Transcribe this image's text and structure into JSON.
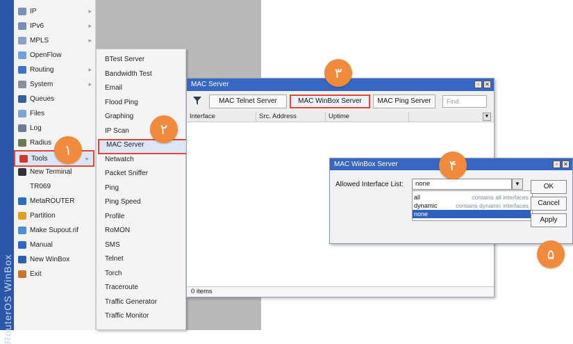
{
  "brand": "RouterOS WinBox",
  "left_menu": {
    "items": [
      {
        "label": "IP",
        "has_arrow": true,
        "icon": "ip-icon"
      },
      {
        "label": "IPv6",
        "has_arrow": true,
        "icon": "ipv6-icon"
      },
      {
        "label": "MPLS",
        "has_arrow": true,
        "icon": "mpls-icon"
      },
      {
        "label": "OpenFlow",
        "has_arrow": false,
        "icon": "openflow-icon"
      },
      {
        "label": "Routing",
        "has_arrow": true,
        "icon": "routing-icon"
      },
      {
        "label": "System",
        "has_arrow": true,
        "icon": "system-icon"
      },
      {
        "label": "Queues",
        "has_arrow": false,
        "icon": "queues-icon"
      },
      {
        "label": "Files",
        "has_arrow": false,
        "icon": "files-icon"
      },
      {
        "label": "Log",
        "has_arrow": false,
        "icon": "log-icon"
      },
      {
        "label": "Radius",
        "has_arrow": false,
        "icon": "radius-icon"
      },
      {
        "label": "Tools",
        "has_arrow": true,
        "icon": "tools-icon"
      },
      {
        "label": "New Terminal",
        "has_arrow": false,
        "icon": "terminal-icon"
      },
      {
        "label": "TR069",
        "has_arrow": false,
        "icon": ""
      },
      {
        "label": "MetaROUTER",
        "has_arrow": false,
        "icon": "metarouter-icon"
      },
      {
        "label": "Partition",
        "has_arrow": false,
        "icon": "partition-icon"
      },
      {
        "label": "Make Supout.rif",
        "has_arrow": false,
        "icon": "supout-icon"
      },
      {
        "label": "Manual",
        "has_arrow": false,
        "icon": "manual-icon"
      },
      {
        "label": "New WinBox",
        "has_arrow": false,
        "icon": "winbox-icon"
      },
      {
        "label": "Exit",
        "has_arrow": false,
        "icon": "exit-icon"
      }
    ]
  },
  "tools_menu": {
    "items": [
      "BTest Server",
      "Bandwidth Test",
      "Email",
      "Flood Ping",
      "Graphing",
      "IP Scan",
      "MAC Server",
      "Netwatch",
      "Packet Sniffer",
      "Ping",
      "Ping Speed",
      "Profile",
      "RoMON",
      "SMS",
      "Telnet",
      "Torch",
      "Traceroute",
      "Traffic Generator",
      "Traffic Monitor"
    ]
  },
  "mac_server": {
    "title": "MAC Server",
    "buttons": {
      "telnet": "MAC Telnet Server",
      "winbox": "MAC WinBox Server",
      "ping": "MAC Ping Server"
    },
    "find_placeholder": "Find",
    "columns": [
      "Interface",
      "Src. Address",
      "Uptime"
    ],
    "status": "0 items"
  },
  "winbox_dialog": {
    "title": "MAC WinBox Server",
    "field_label": "Allowed Interface List:",
    "selected_value": "none",
    "options": [
      {
        "value": "all",
        "description": "contains all interfaces"
      },
      {
        "value": "dynamic",
        "description": "contains dynamic interfaces"
      },
      {
        "value": "none",
        "description": ""
      }
    ],
    "buttons": {
      "ok": "OK",
      "cancel": "Cancel",
      "apply": "Apply"
    }
  },
  "badges": [
    "١",
    "٢",
    "٣",
    "۴",
    "۵"
  ],
  "colors": {
    "titlebar": "#3767c2",
    "highlight": "#e2463a",
    "badge": "#f08a3c"
  }
}
